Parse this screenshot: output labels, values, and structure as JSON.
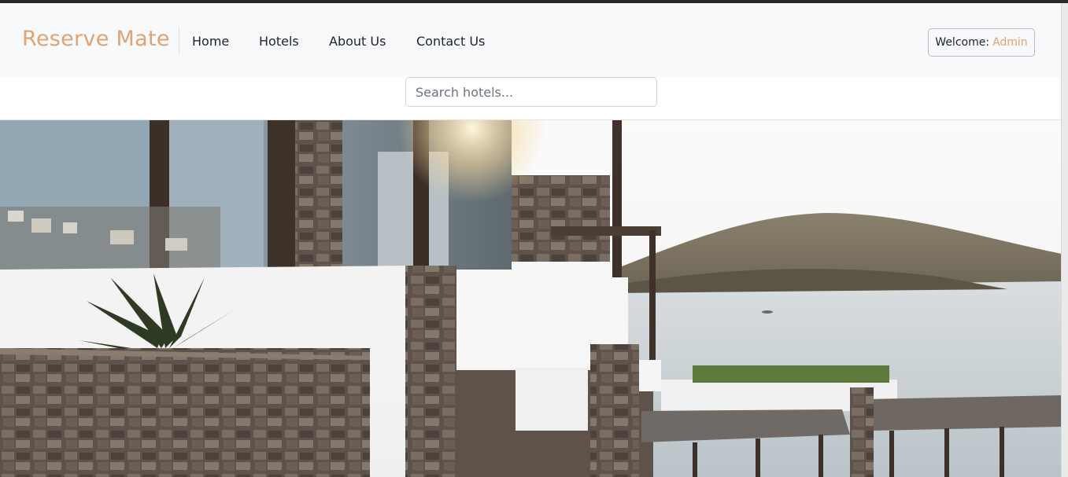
{
  "navbar": {
    "brand": "Reserve Mate",
    "links": [
      {
        "label": "Home"
      },
      {
        "label": "Hotels"
      },
      {
        "label": "About Us"
      },
      {
        "label": "Contact Us"
      }
    ],
    "welcome_label": "Welcome:",
    "welcome_user": "Admin"
  },
  "search": {
    "placeholder": "Search hotels..."
  },
  "colors": {
    "brand": "#e0a371",
    "navbar_bg": "#f8f9fa",
    "text": "#212529"
  }
}
